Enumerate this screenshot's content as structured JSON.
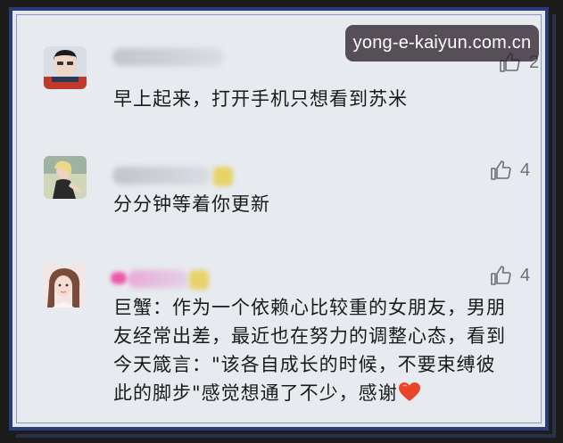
{
  "watermark": {
    "text": "yong-e-kaiyun.com.cn"
  },
  "comments": [
    {
      "text": "早上起来，打开手机只想看到苏米",
      "likes": "2"
    },
    {
      "text": "分分钟等着你更新",
      "likes": "4"
    },
    {
      "lines": [
        "巨蟹：作为一个依赖心比较重的女朋友，男朋",
        "友经常出差，最近也在努力的调整心态，看到",
        "今天箴言：\"该各自成长的时候，不要束缚彼",
        "此的脚步\"感觉想通了不少，感谢"
      ],
      "emoji": "red-heart",
      "likes": "4"
    }
  ],
  "colors": {
    "frame": "#2a3c78",
    "background": "#e7eaee",
    "text": "#1a1a1a",
    "muted": "#6b7077",
    "heart": "#e8452a"
  },
  "icons": {
    "like": "thumbs-up-icon"
  }
}
